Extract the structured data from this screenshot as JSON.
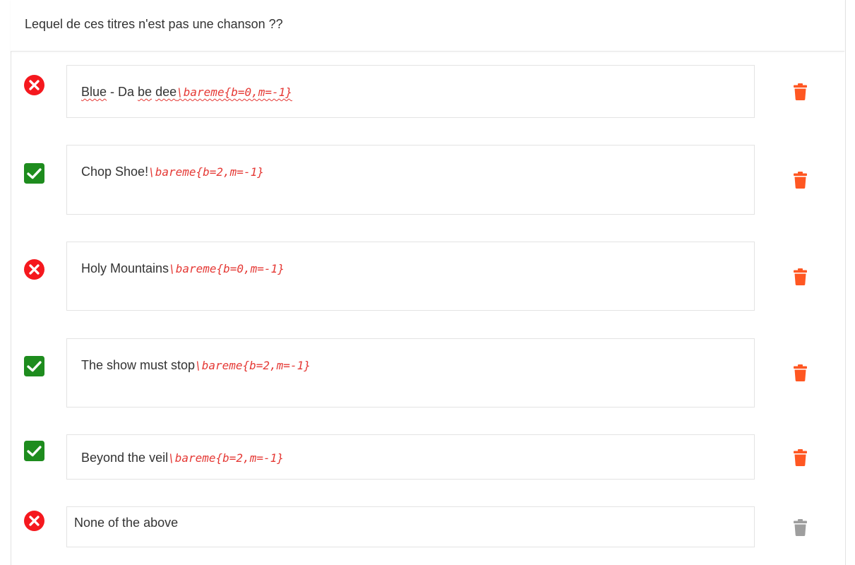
{
  "question": {
    "text": "Lequel de ces titres n'est pas une chanson ??"
  },
  "answers": [
    {
      "status": "incorrect",
      "title": "Blue - Da be dee",
      "title_parts": [
        "Blue",
        " - Da ",
        "be",
        " ",
        "dee"
      ],
      "macro": "\\bareme{b=0,m=-1}",
      "delete_color": "#ff5722"
    },
    {
      "status": "correct",
      "title": "Chop Shoe!",
      "macro": "\\bareme{b=2,m=-1}",
      "delete_color": "#ff5722"
    },
    {
      "status": "incorrect",
      "title": "Holy Mountains",
      "macro": "\\bareme{b=0,m=-1}",
      "delete_color": "#ff5722"
    },
    {
      "status": "correct",
      "title": "The show must stop",
      "macro": "\\bareme{b=2,m=-1}",
      "delete_color": "#ff5722"
    },
    {
      "status": "correct",
      "title": "Beyond the veil",
      "macro": "\\bareme{b=2,m=-1}",
      "delete_color": "#ff5722"
    },
    {
      "status": "incorrect",
      "title": "None of the above",
      "macro": "",
      "delete_color": "#9e9e9e"
    }
  ],
  "colors": {
    "correct": "#1e8c1e",
    "incorrect": "#f5181e",
    "macro": "#e53935"
  },
  "icons": {
    "correct": "check-box-icon",
    "incorrect": "cross-circle-icon",
    "delete": "trash-icon"
  }
}
